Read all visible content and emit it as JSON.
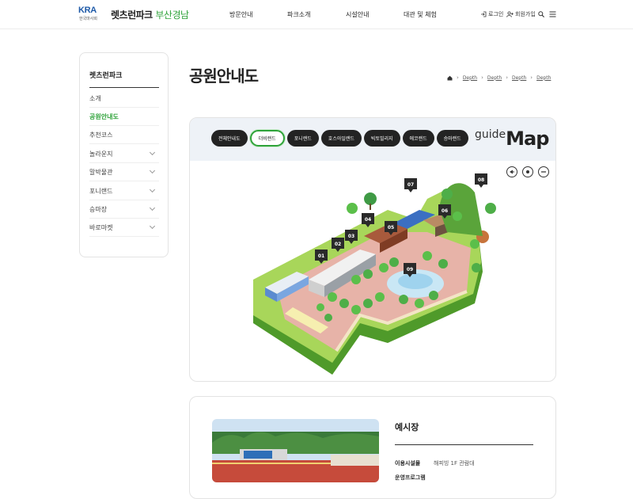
{
  "header": {
    "logo_text": "KRA",
    "logo_sub": "한국마사회",
    "brand_main": "렛츠런파크",
    "brand_sub": "부산경남",
    "nav": [
      "방문안내",
      "파크소개",
      "시설안내",
      "대관 및 체험"
    ],
    "login_label": "로그인",
    "signup_label": "회원가입",
    "icons": [
      "login-icon",
      "user-plus-icon",
      "search-icon",
      "menu-icon"
    ]
  },
  "sidebar": {
    "title": "렛츠런파크",
    "items": [
      {
        "label": "소개",
        "active": false,
        "expandable": false
      },
      {
        "label": "공원안내도",
        "active": true,
        "expandable": false
      },
      {
        "label": "추천코스",
        "active": false,
        "expandable": false
      },
      {
        "label": "놀라운지",
        "active": false,
        "expandable": true
      },
      {
        "label": "말박물관",
        "active": false,
        "expandable": true
      },
      {
        "label": "포니랜드",
        "active": false,
        "expandable": true
      },
      {
        "label": "승마장",
        "active": false,
        "expandable": true
      },
      {
        "label": "바로마켓",
        "active": false,
        "expandable": true
      }
    ]
  },
  "page": {
    "title": "공원안내도",
    "breadcrumb": [
      "Depth",
      "Depth",
      "Depth",
      "Depth"
    ]
  },
  "map": {
    "tabs": [
      {
        "label": "전체안내도",
        "active": false
      },
      {
        "label": "더비랜드",
        "active": true
      },
      {
        "label": "포니랜드",
        "active": false
      },
      {
        "label": "호스아일랜드",
        "active": false
      },
      {
        "label": "빅토빌리지",
        "active": false
      },
      {
        "label": "에코랜드",
        "active": false
      },
      {
        "label": "승마랜드",
        "active": false
      }
    ],
    "guide_small": "guide",
    "guide_big": "Map",
    "markers": [
      "01",
      "02",
      "03",
      "04",
      "05",
      "06",
      "07",
      "08",
      "09"
    ],
    "controls": [
      "zoom-in-icon",
      "reset-icon",
      "zoom-out-icon"
    ],
    "accent_color": "#2fa33a"
  },
  "facility": {
    "title": "예시장",
    "usage_label": "이용시설물",
    "usage_value": "해피빙 1F 관람대",
    "second_label": "운영프로그램"
  },
  "colors": {
    "accent": "#2fa33a",
    "brand_blue": "#1e5aa8",
    "tab_dark": "#232323",
    "marker_dark": "#2a2a2a"
  }
}
